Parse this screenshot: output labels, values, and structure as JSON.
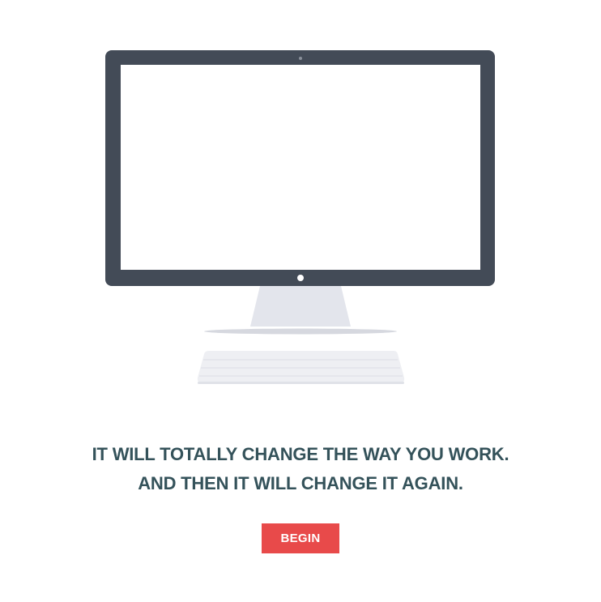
{
  "hero": {
    "line1": "IT WILL TOTALLY CHANGE THE WAY YOU WORK.",
    "line2": "AND THEN IT WILL CHANGE IT AGAIN."
  },
  "cta": {
    "label": "BEGIN"
  },
  "colors": {
    "monitor_bezel": "#434b57",
    "screen": "#ffffff",
    "stand": "#e3e5ec",
    "keyboard": "#eeeff3",
    "headline": "#34525a",
    "button": "#e84a4a"
  },
  "icons": {
    "illustration": "desktop-computer-icon"
  }
}
